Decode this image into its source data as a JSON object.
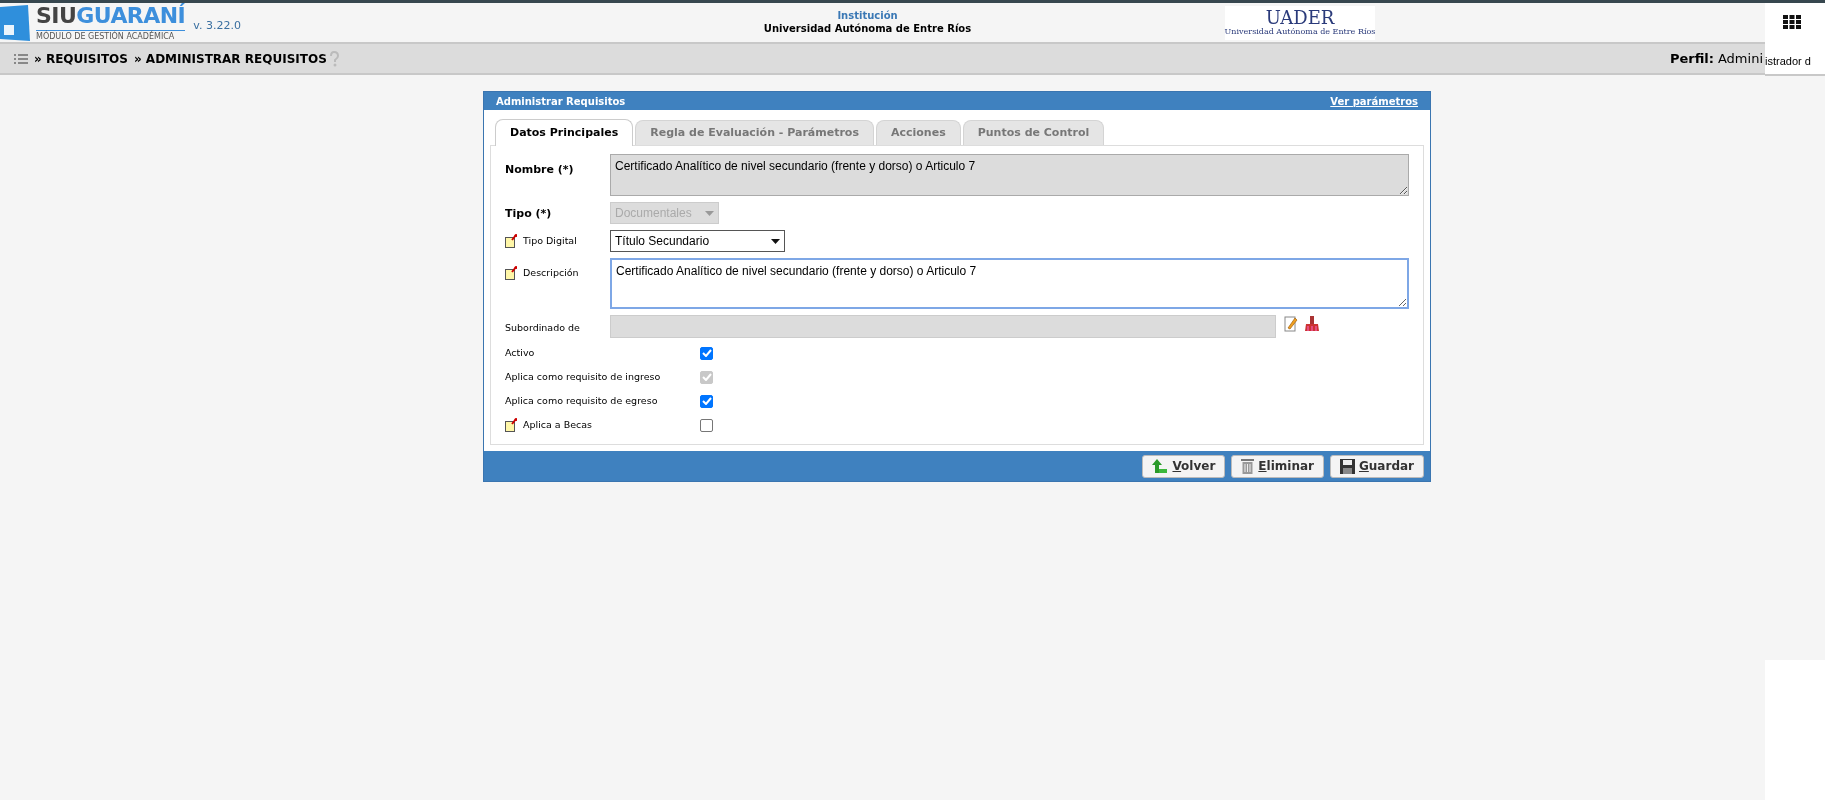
{
  "header": {
    "logo_part_1": "SIU",
    "logo_part_2": "GUARANÍ",
    "logo_subtitle": "MÓDULO DE GESTIÓN ACADÉMICA",
    "version": "v. 3.22.0",
    "institution_label": "Institución",
    "institution_name": "Universidad Autónoma de Entre Ríos",
    "uader_logo": "UADER",
    "uader_subtitle": "Universidad Autónoma de Entre Ríos"
  },
  "breadcrumb": [
    "» REQUISITOS",
    "» ADMINISTRAR REQUISITOS"
  ],
  "profile": {
    "label": "Perfil:",
    "value": "Admini",
    "overlay_text": "istrador d"
  },
  "form": {
    "title": "Administrar Requisitos",
    "link": "Ver parámetros",
    "tabs": [
      {
        "label": "Datos Principales",
        "selected": true
      },
      {
        "label": "Regla de Evaluación - Parámetros",
        "selected": false
      },
      {
        "label": "Acciones",
        "selected": false
      },
      {
        "label": "Puntos de Control",
        "selected": false
      }
    ],
    "fields": [
      {
        "kind": "textarea",
        "label": "Nombre (*)",
        "required": true,
        "note": false,
        "disabled": true,
        "value": "Certificado Analítico de nivel secundario (frente y dorso) o Articulo 7"
      },
      {
        "kind": "select",
        "label": "Tipo (*)",
        "required": true,
        "note": false,
        "disabled": true,
        "value": "Documentales"
      },
      {
        "kind": "select",
        "label": "Tipo Digital",
        "required": false,
        "note": true,
        "disabled": false,
        "value": "Título Secundario"
      },
      {
        "kind": "textarea",
        "label": "Descripción",
        "required": false,
        "note": true,
        "disabled": false,
        "value": "Certificado Analítico de nivel secundario (frente y dorso) o Articulo 7"
      },
      {
        "kind": "lookup",
        "label": "Subordinado de",
        "required": false,
        "note": false,
        "disabled": true
      },
      {
        "kind": "checkbox",
        "label": "Activo",
        "required": false,
        "note": false,
        "disabled": false,
        "checked": true
      },
      {
        "kind": "checkbox",
        "label": "Aplica como requisito de ingreso",
        "required": false,
        "note": false,
        "disabled": true,
        "checked": true
      },
      {
        "kind": "checkbox",
        "label": "Aplica como requisito de egreso",
        "required": false,
        "note": false,
        "disabled": false,
        "checked": true
      },
      {
        "kind": "checkbox",
        "label": "Aplica a Becas",
        "required": false,
        "note": true,
        "disabled": false,
        "checked": false
      }
    ],
    "buttons": [
      {
        "kind": "back",
        "label": "Volver"
      },
      {
        "kind": "delete",
        "label": "Eliminar"
      },
      {
        "kind": "save",
        "label": "Guardar"
      }
    ]
  }
}
